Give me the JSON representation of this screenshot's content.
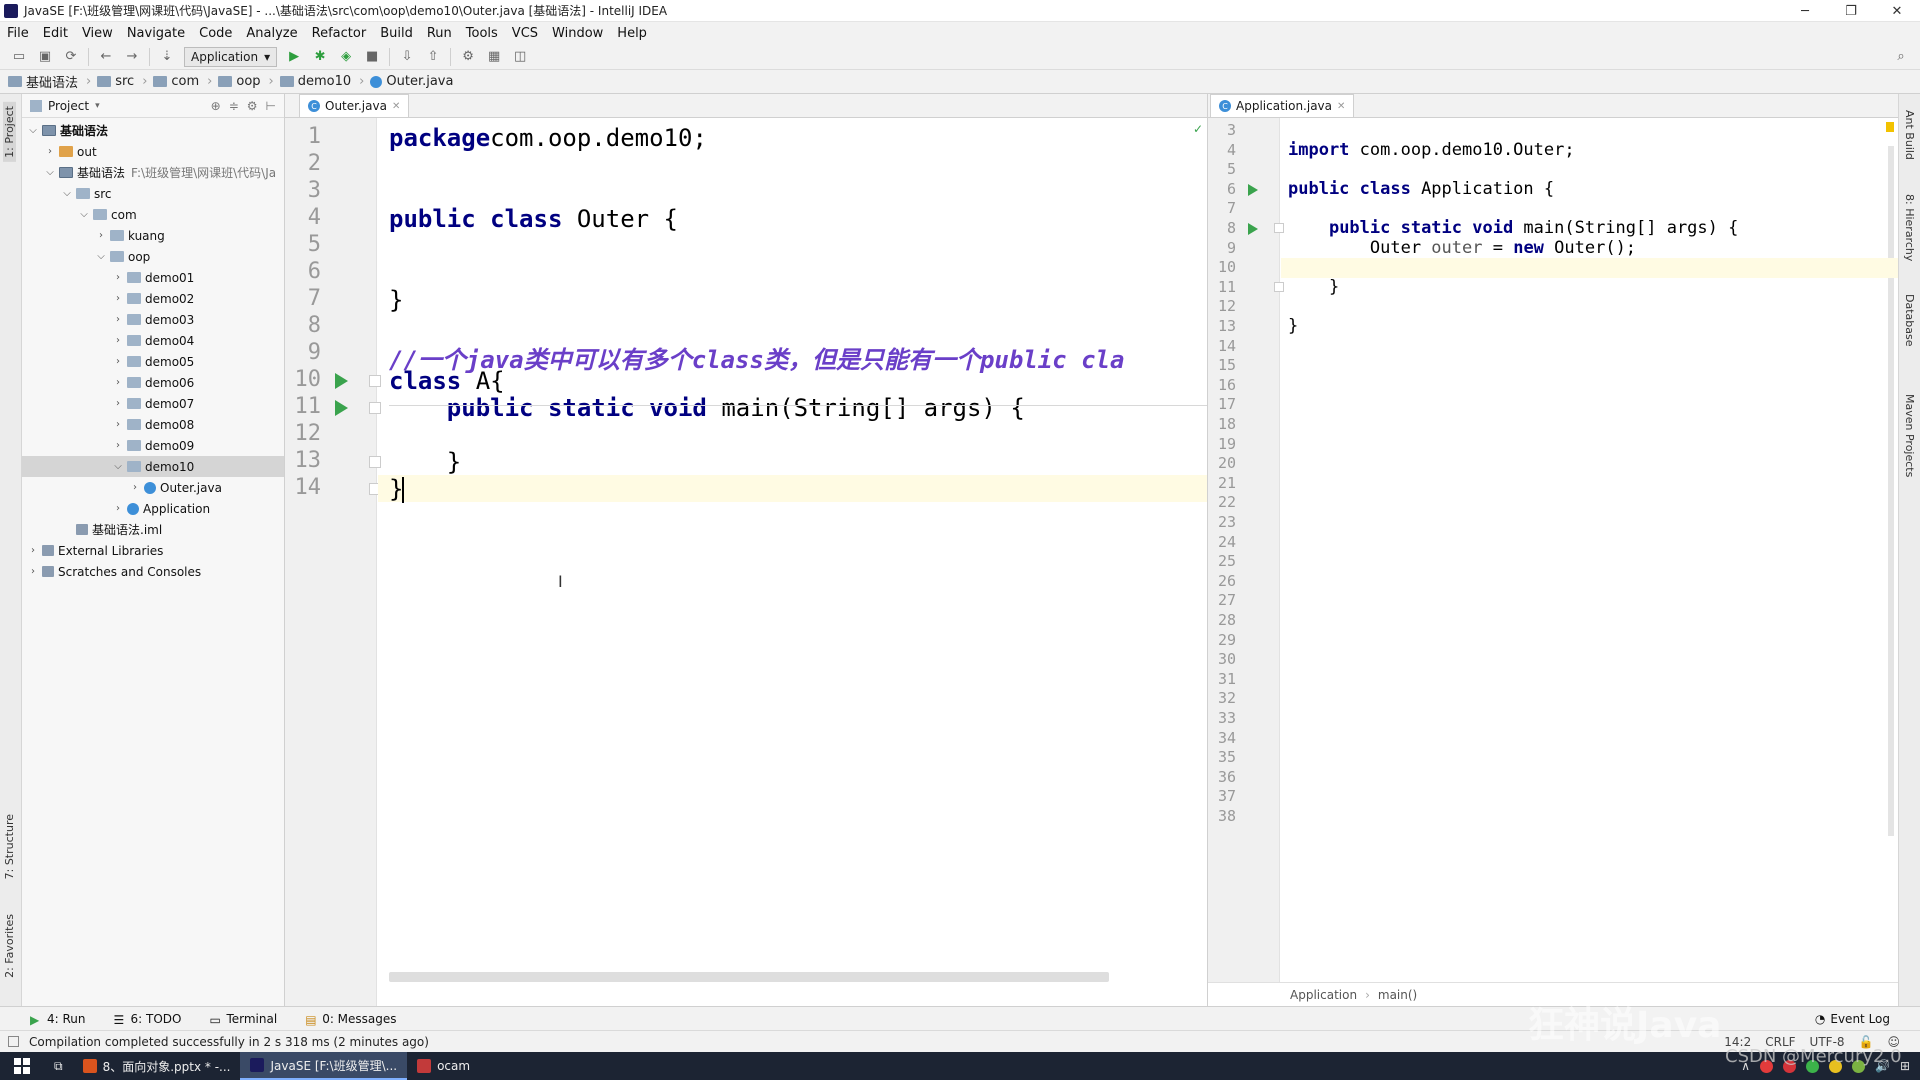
{
  "window": {
    "title": "JavaSE [F:\\班级管理\\网课班\\代码\\JavaSE] - ...\\基础语法\\src\\com\\oop\\demo10\\Outer.java [基础语法] - IntelliJ IDEA",
    "minimize": "─",
    "maximize": "❐",
    "close": "✕"
  },
  "menu": [
    "File",
    "Edit",
    "View",
    "Navigate",
    "Code",
    "Analyze",
    "Refactor",
    "Build",
    "Run",
    "Tools",
    "VCS",
    "Window",
    "Help"
  ],
  "toolbar": {
    "run_config": "Application"
  },
  "breadcrumb": [
    "基础语法",
    "src",
    "com",
    "oop",
    "demo10",
    "Outer.java"
  ],
  "left_stripe": {
    "project": "1: Project",
    "structure": "7: Structure",
    "favorites": "2: Favorites"
  },
  "right_stripe": {
    "ant": "Ant Build",
    "hierarchy": "8: Hierarchy",
    "database": "Database",
    "maven": "Maven Projects"
  },
  "project": {
    "header": "Project",
    "tree": [
      {
        "label": "基础语法",
        "depth": 0,
        "arrow": "v",
        "icon": "module",
        "bold": true
      },
      {
        "label": "out",
        "depth": 1,
        "arrow": ">",
        "icon": "folder-orange"
      },
      {
        "label": "基础语法",
        "hint": "F:\\班级管理\\网课班\\代码\\Ja",
        "depth": 1,
        "arrow": "v",
        "icon": "module"
      },
      {
        "label": "src",
        "depth": 2,
        "arrow": "v",
        "icon": "folder"
      },
      {
        "label": "com",
        "depth": 3,
        "arrow": "v",
        "icon": "folder"
      },
      {
        "label": "kuang",
        "depth": 4,
        "arrow": ">",
        "icon": "folder"
      },
      {
        "label": "oop",
        "depth": 4,
        "arrow": "v",
        "icon": "folder"
      },
      {
        "label": "demo01",
        "depth": 5,
        "arrow": ">",
        "icon": "folder"
      },
      {
        "label": "demo02",
        "depth": 5,
        "arrow": ">",
        "icon": "folder"
      },
      {
        "label": "demo03",
        "depth": 5,
        "arrow": ">",
        "icon": "folder"
      },
      {
        "label": "demo04",
        "depth": 5,
        "arrow": ">",
        "icon": "folder"
      },
      {
        "label": "demo05",
        "depth": 5,
        "arrow": ">",
        "icon": "folder"
      },
      {
        "label": "demo06",
        "depth": 5,
        "arrow": ">",
        "icon": "folder"
      },
      {
        "label": "demo07",
        "depth": 5,
        "arrow": ">",
        "icon": "folder"
      },
      {
        "label": "demo08",
        "depth": 5,
        "arrow": ">",
        "icon": "folder"
      },
      {
        "label": "demo09",
        "depth": 5,
        "arrow": ">",
        "icon": "folder"
      },
      {
        "label": "demo10",
        "depth": 5,
        "arrow": "v",
        "icon": "folder",
        "selected": true
      },
      {
        "label": "Outer.java",
        "depth": 6,
        "arrow": ">",
        "icon": "java"
      },
      {
        "label": "Application",
        "depth": 5,
        "arrow": ">",
        "icon": "java"
      },
      {
        "label": "基础语法.iml",
        "depth": 2,
        "arrow": "",
        "icon": "lib"
      },
      {
        "label": "External Libraries",
        "depth": 0,
        "arrow": ">",
        "icon": "lib"
      },
      {
        "label": "Scratches and Consoles",
        "depth": 0,
        "arrow": ">",
        "icon": "lib"
      }
    ]
  },
  "editor1": {
    "tab": "Outer.java",
    "lines": [
      {
        "n": "1",
        "code": [
          [
            "kw",
            "package"
          ],
          [
            "",
            "com.oop.demo10;"
          ]
        ]
      },
      {
        "n": "2",
        "code": []
      },
      {
        "n": "3",
        "code": []
      },
      {
        "n": "4",
        "code": [
          [
            "kw",
            "public class"
          ],
          [
            "",
            " Outer {"
          ]
        ]
      },
      {
        "n": "5",
        "code": []
      },
      {
        "n": "6",
        "code": []
      },
      {
        "n": "7",
        "code": [
          [
            "",
            "}"
          ]
        ]
      },
      {
        "n": "8",
        "code": []
      },
      {
        "n": "9",
        "code": [
          [
            "cmt",
            "//一个java类中可以有多个class类，但是只能有一个public cla"
          ]
        ]
      },
      {
        "n": "10",
        "code": [
          [
            "kw",
            "class"
          ],
          [
            "",
            " A{"
          ]
        ]
      },
      {
        "n": "11",
        "code": [
          [
            "",
            "    "
          ],
          [
            "kw",
            "public static void"
          ],
          [
            "",
            " main(String[] args) {"
          ]
        ]
      },
      {
        "n": "12",
        "code": []
      },
      {
        "n": "13",
        "code": [
          [
            "",
            "    }"
          ]
        ]
      },
      {
        "n": "14",
        "code": [
          [
            "",
            "}"
          ]
        ]
      }
    ]
  },
  "editor2": {
    "tab": "Application.java",
    "lines": [
      {
        "n": "3",
        "code": []
      },
      {
        "n": "4",
        "code": [
          [
            "kw",
            "import"
          ],
          [
            "",
            " com.oop.demo10.Outer;"
          ]
        ]
      },
      {
        "n": "5",
        "code": []
      },
      {
        "n": "6",
        "code": [
          [
            "kw",
            "public class"
          ],
          [
            "",
            " Application {"
          ]
        ]
      },
      {
        "n": "7",
        "code": []
      },
      {
        "n": "8",
        "code": [
          [
            "",
            "    "
          ],
          [
            "kw",
            "public static void"
          ],
          [
            "",
            " main(String[] args) {"
          ]
        ]
      },
      {
        "n": "9",
        "code": [
          [
            "",
            "        Outer "
          ],
          [
            "var",
            "outer"
          ],
          [
            "",
            " = "
          ],
          [
            "kw",
            "new"
          ],
          [
            "",
            " Outer();"
          ]
        ]
      },
      {
        "n": "10",
        "code": []
      },
      {
        "n": "11",
        "code": [
          [
            "",
            "    }"
          ]
        ]
      },
      {
        "n": "12",
        "code": []
      },
      {
        "n": "13",
        "code": [
          [
            "",
            "}"
          ]
        ]
      },
      {
        "n": "14",
        "code": []
      },
      {
        "n": "15",
        "code": []
      },
      {
        "n": "16",
        "code": []
      },
      {
        "n": "17",
        "code": []
      },
      {
        "n": "18",
        "code": []
      },
      {
        "n": "19",
        "code": []
      },
      {
        "n": "20",
        "code": []
      },
      {
        "n": "21",
        "code": []
      },
      {
        "n": "22",
        "code": []
      },
      {
        "n": "23",
        "code": []
      },
      {
        "n": "24",
        "code": []
      },
      {
        "n": "25",
        "code": []
      },
      {
        "n": "26",
        "code": []
      },
      {
        "n": "27",
        "code": []
      },
      {
        "n": "28",
        "code": []
      },
      {
        "n": "29",
        "code": []
      },
      {
        "n": "30",
        "code": []
      },
      {
        "n": "31",
        "code": []
      },
      {
        "n": "32",
        "code": []
      },
      {
        "n": "33",
        "code": []
      },
      {
        "n": "34",
        "code": []
      },
      {
        "n": "35",
        "code": []
      },
      {
        "n": "36",
        "code": []
      },
      {
        "n": "37",
        "code": []
      },
      {
        "n": "38",
        "code": []
      }
    ],
    "breadcrumb": [
      "Application",
      "main()"
    ]
  },
  "bottom_tools": [
    "4: Run",
    "6: TODO",
    "Terminal",
    "0: Messages"
  ],
  "event_log": "Event Log",
  "status": {
    "message": "Compilation completed successfully in 2 s 318 ms (2 minutes ago)",
    "position": "14:2",
    "line_sep": "CRLF",
    "encoding": "UTF-8"
  },
  "taskbar": {
    "tasks": [
      {
        "label": "8、面向对象.pptx * -...",
        "color": "#d9541e",
        "active": false
      },
      {
        "label": "JavaSE [F:\\班级管理\\...",
        "color": "#1b1b5c",
        "active": true
      },
      {
        "label": "ocam",
        "color": "#c23a3a",
        "active": false
      }
    ]
  },
  "watermark": "狂神说Java",
  "csdn": "CSDN @Mercury2.0"
}
